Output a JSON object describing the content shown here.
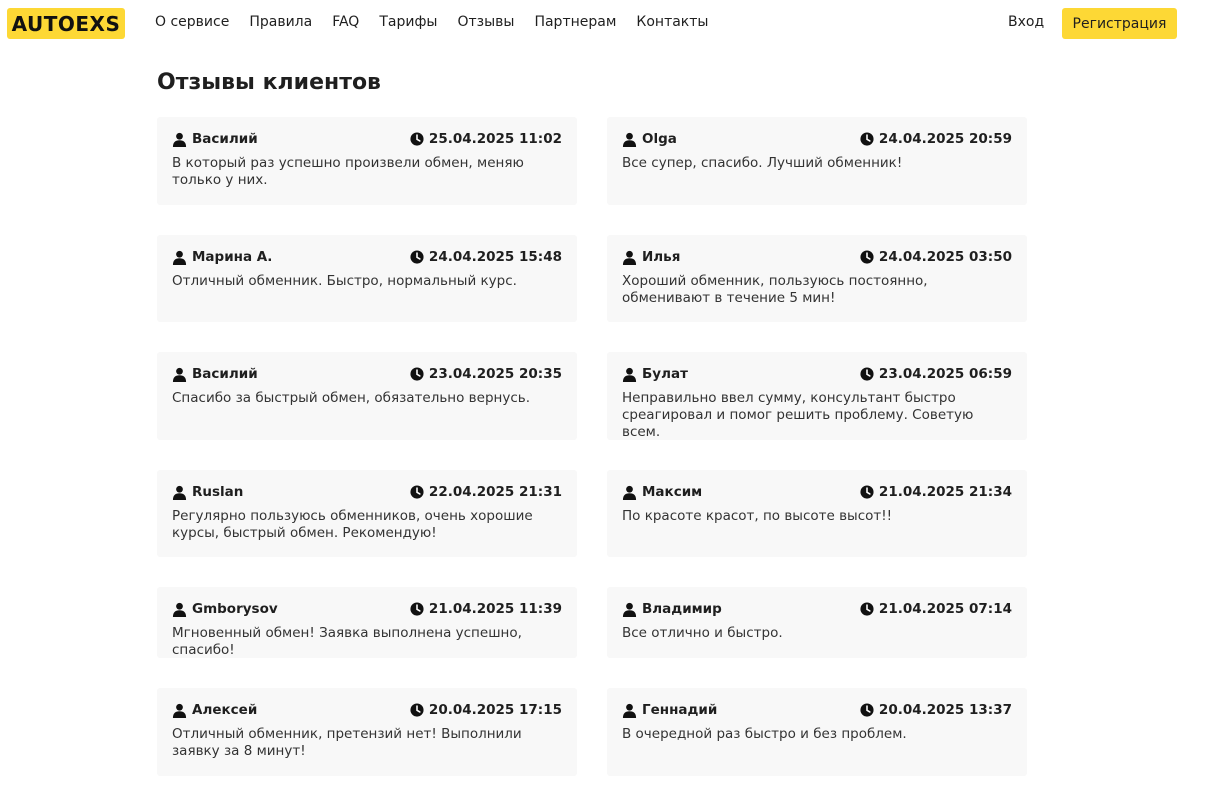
{
  "header": {
    "logo": "AUTOEXS",
    "nav": [
      "О сервисе",
      "Правила",
      "FAQ",
      "Тарифы",
      "Отзывы",
      "Партнерам",
      "Контакты"
    ],
    "login": "Вход",
    "register": "Регистрация"
  },
  "page": {
    "title": "Отзывы клиентов"
  },
  "colors": {
    "accent": "#fdd835",
    "card_bg": "#f8f8f8"
  },
  "reviews": [
    {
      "author": "Василий",
      "date": "25.04.2025 11:02",
      "text": "В который раз успешно произвели обмен, меняю только у них."
    },
    {
      "author": "Olga",
      "date": "24.04.2025 20:59",
      "text": "Все супер, спасибо. Лучший обменник!"
    },
    {
      "author": "Марина А.",
      "date": "24.04.2025 15:48",
      "text": "Отличный обменник. Быстро, нормальный курс."
    },
    {
      "author": "Илья",
      "date": "24.04.2025 03:50",
      "text": "Хороший обменник, пользуюсь постоянно, обменивают в течение 5 мин!"
    },
    {
      "author": "Василий",
      "date": "23.04.2025 20:35",
      "text": "Спасибо за быстрый обмен, обязательно вернусь."
    },
    {
      "author": "Булат",
      "date": "23.04.2025 06:59",
      "text": "Неправильно ввел сумму, консультант быстро среагировал и помог решить проблему. Советую всем."
    },
    {
      "author": "Ruslan",
      "date": "22.04.2025 21:31",
      "text": "Регулярно пользуюсь обменников, очень хорошие курсы, быстрый обмен. Рекомендую!"
    },
    {
      "author": "Максим",
      "date": "21.04.2025 21:34",
      "text": "По красоте красот, по высоте высот!!"
    },
    {
      "author": "Gmborysov",
      "date": "21.04.2025 11:39",
      "text": "Мгновенный обмен! Заявка выполнена успешно, спасибо!"
    },
    {
      "author": "Владимир",
      "date": "21.04.2025 07:14",
      "text": "Все отлично и быстро."
    },
    {
      "author": "Алексей",
      "date": "20.04.2025 17:15",
      "text": "Отличный обменник, претензий нет! Выполнили заявку за 8 минут!"
    },
    {
      "author": "Геннадий",
      "date": "20.04.2025 13:37",
      "text": "В очередной раз быстро и без проблем."
    }
  ],
  "icons": {
    "author": "user-icon",
    "date": "clock-icon"
  }
}
